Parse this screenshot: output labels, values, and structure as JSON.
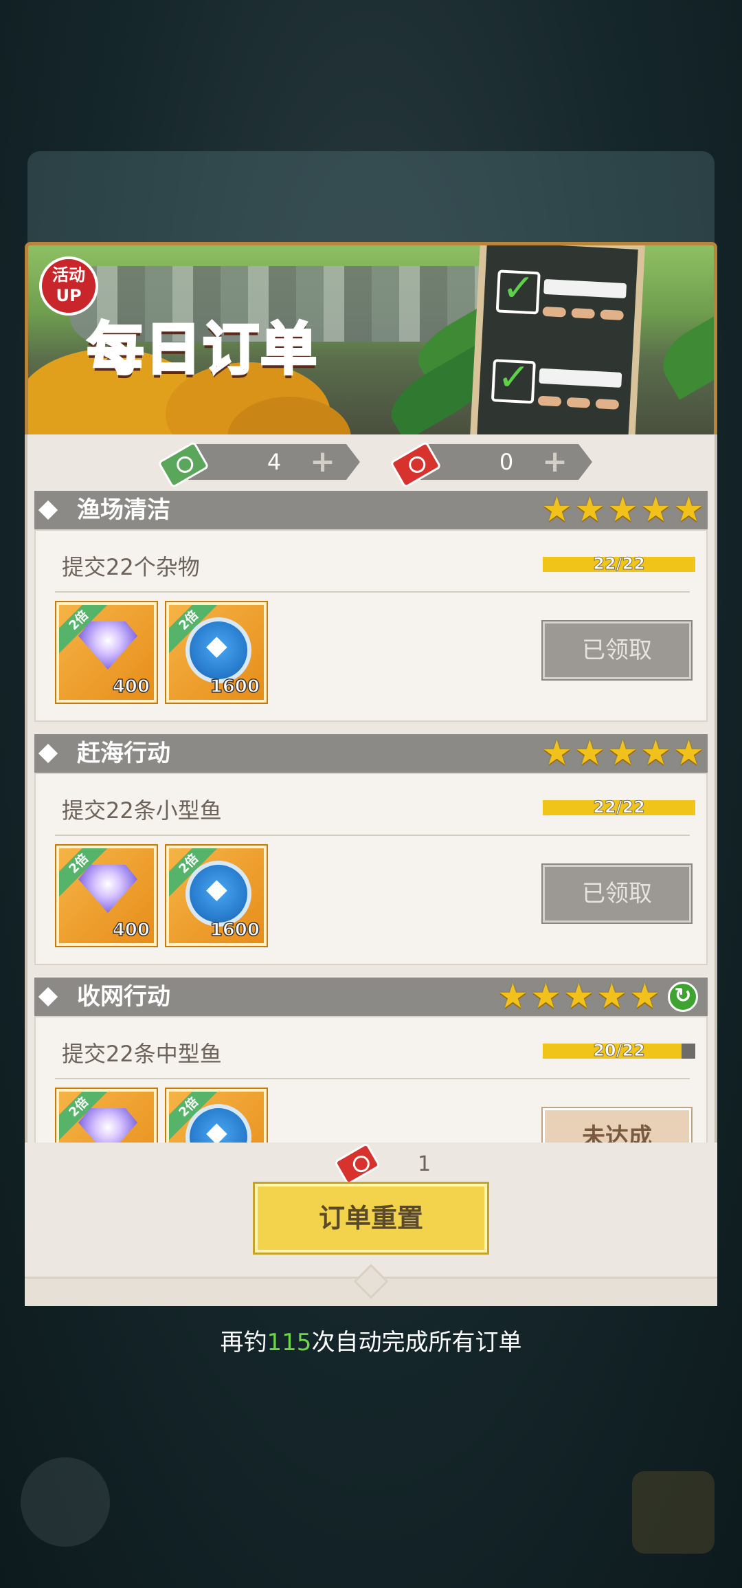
{
  "banner": {
    "badge_top": "活动",
    "badge_bottom": "UP",
    "title": "每日订单"
  },
  "currencies": [
    {
      "icon": "green-ticket-icon",
      "value": "4"
    },
    {
      "icon": "red-ticket-icon",
      "value": "0"
    }
  ],
  "orders": [
    {
      "name": "渔场清洁",
      "stars": 5,
      "task": "提交22个杂物",
      "progress_text": "22/22",
      "progress": 1.0,
      "rewards": [
        {
          "type": "gem",
          "multiplier": "2倍",
          "qty": "400"
        },
        {
          "type": "fish-coin",
          "multiplier": "2倍",
          "qty": "1600"
        }
      ],
      "button": "已领取"
    },
    {
      "name": "赶海行动",
      "stars": 5,
      "task": "提交22条小型鱼",
      "progress_text": "22/22",
      "progress": 1.0,
      "rewards": [
        {
          "type": "gem",
          "multiplier": "2倍",
          "qty": "400"
        },
        {
          "type": "fish-coin",
          "multiplier": "2倍",
          "qty": "1600"
        }
      ],
      "button": "已领取"
    },
    {
      "name": "收网行动",
      "stars": 5,
      "task": "提交22条中型鱼",
      "progress_text": "20/22",
      "progress": 0.909,
      "rewards": [
        {
          "type": "gem",
          "multiplier": "2倍"
        },
        {
          "type": "fish-coin",
          "multiplier": "2倍"
        }
      ],
      "button": "未达成"
    }
  ],
  "reset": {
    "cost": "1",
    "label": "订单重置"
  },
  "footnote": {
    "prefix": "再钓",
    "count": "115",
    "suffix": "次自动完成所有订单"
  },
  "colors": {
    "progress": "#f0c419",
    "accent_green": "#6fd64a",
    "header": "#8c8a86"
  }
}
